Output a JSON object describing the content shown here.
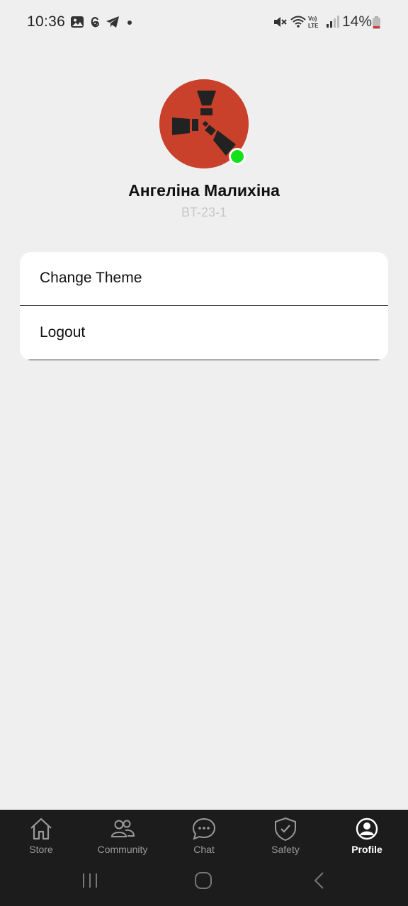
{
  "status_bar": {
    "time": "10:36",
    "battery": "14%",
    "icons": [
      "gallery-icon",
      "threads-icon",
      "telegram-icon",
      "mute-icon",
      "wifi-icon",
      "volte-icon",
      "signal-icon",
      "battery-icon"
    ]
  },
  "profile": {
    "name": "Ангеліна Малихіна",
    "group": "BT-23-1",
    "online_color": "#14e01a",
    "avatar_color": "#c9412a"
  },
  "menu": {
    "items": [
      {
        "label": "Change Theme"
      },
      {
        "label": "Logout"
      }
    ]
  },
  "nav": {
    "items": [
      {
        "label": "Store",
        "icon": "home-icon",
        "active": false
      },
      {
        "label": "Community",
        "icon": "people-icon",
        "active": false
      },
      {
        "label": "Chat",
        "icon": "chat-icon",
        "active": false
      },
      {
        "label": "Safety",
        "icon": "shield-icon",
        "active": false
      },
      {
        "label": "Profile",
        "icon": "profile-icon",
        "active": true
      }
    ]
  },
  "system_nav": {
    "icons": [
      "recent-apps-icon",
      "home-button-icon",
      "back-icon"
    ]
  }
}
